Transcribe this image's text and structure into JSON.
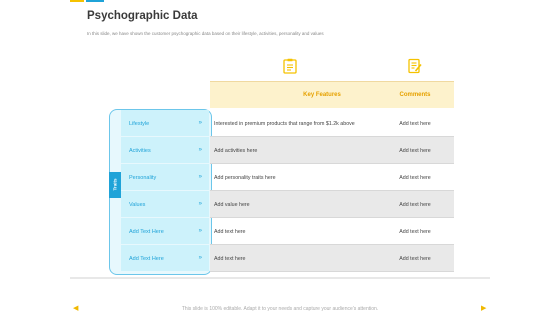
{
  "slide": {
    "title": "Psychographic Data",
    "subtitle": "In this slide, we have shown the customer psychographic data based on their lifestyle, activities, personality and values"
  },
  "icons": {
    "key_features": "clipboard-icon",
    "comments": "edit-note-icon",
    "nav_prev": "triangle-left-icon",
    "nav_next": "triangle-right-icon"
  },
  "table": {
    "headers": {
      "key_features": "Key Features",
      "comments": "Comments"
    },
    "group_label": "Traits",
    "rows": [
      {
        "trait": "Lifestyle",
        "feature": "Interested in premium products that range from $1.2k above",
        "comment": "Add text here"
      },
      {
        "trait": "Activities",
        "feature": "Add activities here",
        "comment": "Add text here"
      },
      {
        "trait": "Personality",
        "feature": "Add personality traits here",
        "comment": "Add text here"
      },
      {
        "trait": "Values",
        "feature": "Add value here",
        "comment": "Add text here"
      },
      {
        "trait": "Add Text Here",
        "feature": "Add text here",
        "comment": "Add text here"
      },
      {
        "trait": "Add Text Here",
        "feature": "Add text here",
        "comment": "Add text here"
      }
    ],
    "chevron": "»"
  },
  "footer": {
    "text": "This slide is 100% editable. Adapt it to your needs and capture your audience's attention.",
    "prev": "◀",
    "next": "▶"
  },
  "colors": {
    "accent_yellow": "#f5c200",
    "accent_blue": "#1fa3d8",
    "header_bg": "#fdf2cc",
    "trait_bg": "#cdf2fb"
  }
}
